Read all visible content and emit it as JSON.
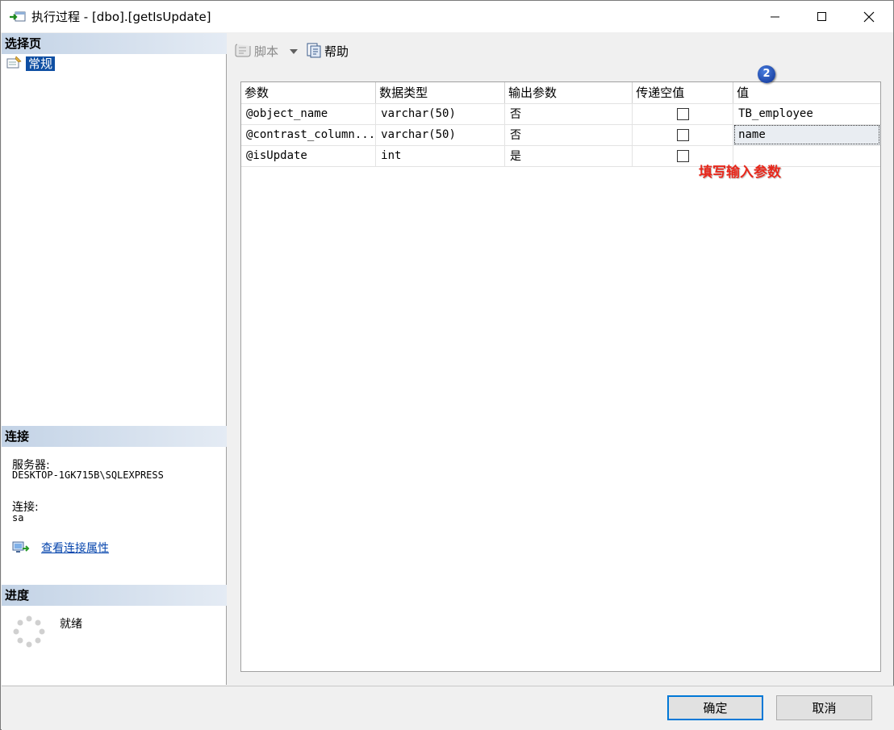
{
  "window": {
    "title": "执行过程 - [dbo].[getIsUpdate]",
    "controls": [
      "minimize",
      "maximize",
      "close"
    ]
  },
  "left_pane": {
    "select_page": {
      "heading": "选择页",
      "items": [
        {
          "label": "常规",
          "icon": "general-page-icon",
          "selected": true
        }
      ]
    },
    "connection": {
      "heading": "连接",
      "server_label": "服务器:",
      "server_value": "DESKTOP-1GK715B\\SQLEXPRESS",
      "connection_label": "连接:",
      "connection_value": "sa",
      "view_link": "查看连接属性"
    },
    "progress": {
      "heading": "进度",
      "status": "就绪"
    }
  },
  "toolbar": {
    "script_label": "脚本",
    "help_label": "帮助"
  },
  "grid": {
    "headers": [
      "参数",
      "数据类型",
      "输出参数",
      "传递空值",
      "值"
    ],
    "rows": [
      {
        "param": "@object_name",
        "type": "varchar(50)",
        "output": "否",
        "pass_null": false,
        "value": "TB_employee"
      },
      {
        "param": "@contrast_column...",
        "type": "varchar(50)",
        "output": "否",
        "pass_null": false,
        "value": "name"
      },
      {
        "param": "@isUpdate",
        "type": "int",
        "output": "是",
        "pass_null": false,
        "value": ""
      }
    ]
  },
  "annotations": {
    "badge": "2",
    "note": "填写输入参数",
    "note_color": "#e8281c"
  },
  "buttons": {
    "ok": "确定",
    "cancel": "取消"
  },
  "colors": {
    "selected_page_bg": "#0f4fa3",
    "link": "#0645ad",
    "primary_button_border": "#0078d7"
  }
}
